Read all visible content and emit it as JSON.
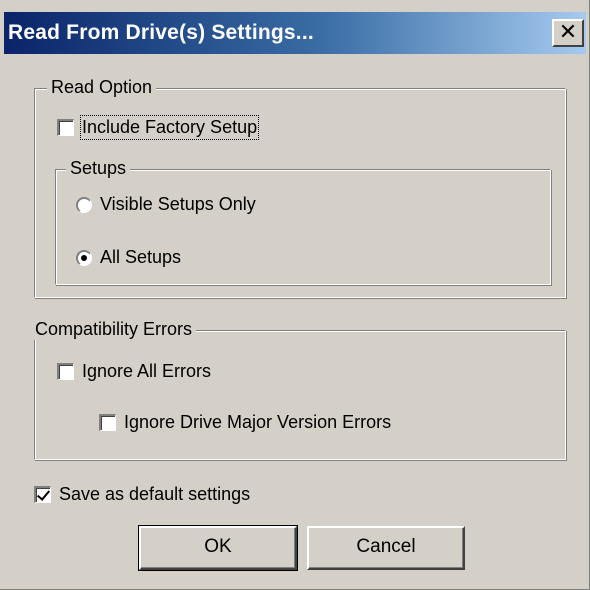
{
  "window": {
    "title": "Read From Drive(s) Settings...",
    "close_symbol": "✕"
  },
  "read_option": {
    "legend": "Read Option",
    "include_factory_setup": {
      "label": "Include Factory Setup",
      "checked": false
    },
    "setups": {
      "legend": "Setups",
      "options": [
        {
          "label": "Visible Setups Only",
          "selected": false
        },
        {
          "label": "All Setups",
          "selected": true
        }
      ]
    }
  },
  "compatibility_errors": {
    "legend": "Compatibility Errors",
    "ignore_all_errors": {
      "label": "Ignore All Errors",
      "checked": false
    },
    "ignore_major_version": {
      "label": "Ignore Drive Major Version Errors",
      "checked": false
    }
  },
  "save_default": {
    "label": "Save as default settings",
    "checked": true
  },
  "buttons": {
    "ok": "OK",
    "cancel": "Cancel"
  },
  "colors": {
    "dialog_bg": "#d4d0c8",
    "title_gradient_start": "#0a246a",
    "title_gradient_end": "#a6caf0",
    "title_text": "#ffffff"
  }
}
